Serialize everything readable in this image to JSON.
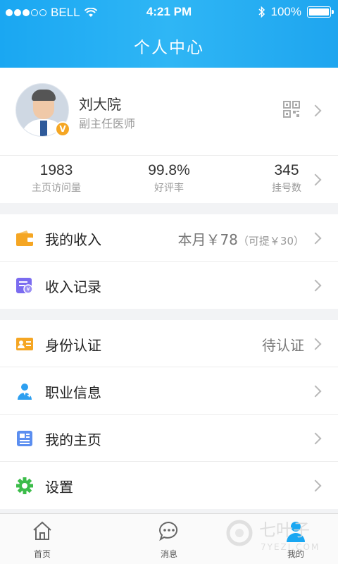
{
  "status_bar": {
    "carrier": "BELL",
    "time": "4:21 PM",
    "battery": "100%"
  },
  "header": {
    "title": "个人中心"
  },
  "profile": {
    "name": "刘大院",
    "role": "副主任医师",
    "badge": "V"
  },
  "stats": [
    {
      "value": "1983",
      "label": "主页访问量"
    },
    {
      "value": "99.8%",
      "label": "好评率"
    },
    {
      "value": "345",
      "label": "挂号数"
    }
  ],
  "income": {
    "my_income_label": "我的收入",
    "month_value": "本月￥78",
    "withdrawable": "（可提￥30）",
    "records_label": "收入记录"
  },
  "menu": {
    "identity_label": "身份认证",
    "identity_status": "待认证",
    "career_label": "职业信息",
    "homepage_label": "我的主页",
    "settings_label": "设置"
  },
  "tabs": [
    {
      "label": "首页"
    },
    {
      "label": "消息"
    },
    {
      "label": "我的"
    }
  ],
  "watermark": {
    "text": "七叶子",
    "url": "7YEZI.COM"
  },
  "colors": {
    "accent": "#1aa7f2",
    "income_icon": "#f5a623",
    "records_icon": "#7b6cf0",
    "id_icon": "#f5a623",
    "career_icon": "#2d9ff0",
    "home_icon": "#5b8ef0",
    "settings_icon": "#3cbc4a"
  }
}
